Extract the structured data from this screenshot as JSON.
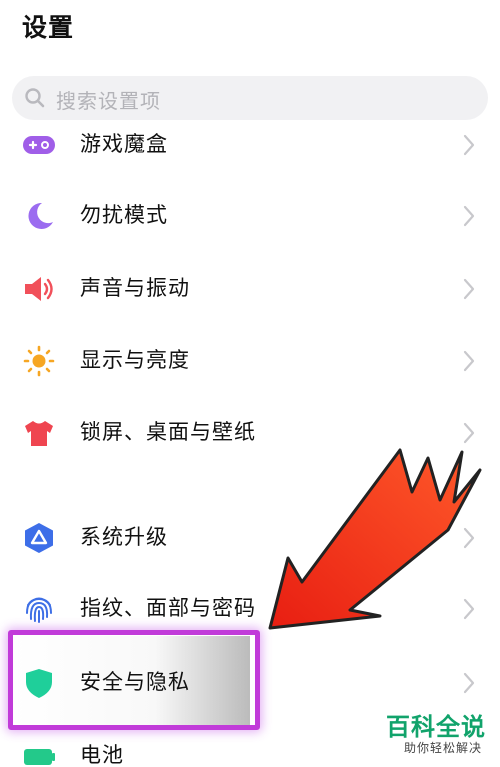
{
  "header": {
    "title": "设置"
  },
  "search": {
    "placeholder": "搜索设置项"
  },
  "settings": [
    {
      "label": "游戏魔盒",
      "icon": "game-box-icon"
    },
    {
      "label": "勿扰模式",
      "icon": "moon-icon"
    },
    {
      "label": "声音与振动",
      "icon": "speaker-icon"
    },
    {
      "label": "显示与亮度",
      "icon": "sun-icon"
    },
    {
      "label": "锁屏、桌面与壁纸",
      "icon": "tshirt-icon"
    },
    {
      "label": "系统升级",
      "icon": "system-update-icon"
    },
    {
      "label": "指纹、面部与密码",
      "icon": "fingerprint-icon"
    },
    {
      "label": "安全与隐私",
      "icon": "shield-icon"
    },
    {
      "label": "电池",
      "icon": "battery-icon"
    }
  ],
  "watermark": {
    "logo": "百科全说",
    "subtitle": "助你轻松解决"
  },
  "colors": {
    "game": "#a05ee8",
    "moon": "#9b6cf0",
    "sound": "#f1505a",
    "display": "#f6a623",
    "theme": "#ef4550",
    "update": "#3d6ee8",
    "fingerprint": "#3e6fe6",
    "security": "#1fcf9a",
    "battery": "#23c98a",
    "highlight": "#c13bd9",
    "arrow": "#f2361d"
  }
}
